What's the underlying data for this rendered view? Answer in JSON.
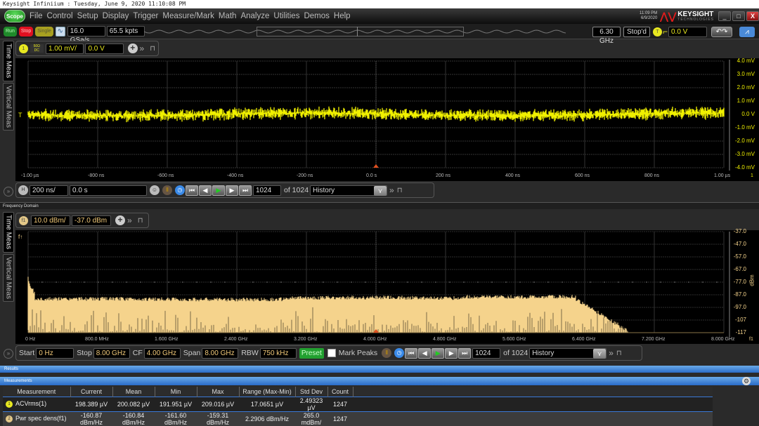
{
  "title_bar": "Keysight Infiniium : Tuesday, June 9, 2020 11:10:08 PM",
  "menu": {
    "scope_button": "Scope",
    "items": [
      "File",
      "Control",
      "Setup",
      "Display",
      "Trigger",
      "Measure/Mark",
      "Math",
      "Analyze",
      "Utilities",
      "Demos",
      "Help"
    ],
    "clock_time": "11:09 PM",
    "clock_date": "6/9/2020",
    "brand": "KEYSIGHT",
    "brand_sub": "TECHNOLOGIES"
  },
  "toolbar": {
    "run": "Run",
    "stop": "Stop",
    "single": "Single",
    "sample_rate": "16.0 GSa/s",
    "memory_depth": "65.5 kpts",
    "bandwidth": "6.30 GHz",
    "acq_status": "Stop'd",
    "trigger_badge": "T",
    "trigger_level": "0.0 V"
  },
  "side_tabs": {
    "time_meas": "Time Meas",
    "vertical_meas": "Vertical Meas"
  },
  "time_panel": {
    "channel_badge": "1",
    "impedance": "50Ω DC",
    "scale": "1.00 mV/",
    "offset": "0.0 V",
    "y_labels": [
      "4.0 mV",
      "3.0 mV",
      "2.0 mV",
      "1.0 mV",
      "0.0 V",
      "-1.0 mV",
      "-2.0 mV",
      "-3.0 mV",
      "-4.0 mV"
    ],
    "x_labels": [
      "-1.00 µs",
      "-800 ns",
      "-600 ns",
      "-400 ns",
      "-200 ns",
      "0.0 s",
      "200 ns",
      "400 ns",
      "600 ns",
      "800 ns",
      "1.00 µs"
    ],
    "right_marker": "1",
    "waveform_color": "#f0f000"
  },
  "horizontal_bar": {
    "badge": "H",
    "time_scale": "200 ns/",
    "delay": "0.0 s",
    "segment": "1024",
    "of_label": "of 1024",
    "history": "History"
  },
  "freq_section_title": "Frequency Domain",
  "freq_panel": {
    "badge": "f1",
    "scale": "10.0 dBm/",
    "offset": "-37.0 dBm",
    "y_labels": [
      "-37.0",
      "-47.0",
      "-57.0",
      "-67.0",
      "-77.0",
      "-87.0",
      "-97.0",
      "-107",
      "-117"
    ],
    "y_unit": "dBm",
    "x_labels": [
      "0 Hz",
      "800.0 MHz",
      "1.600 GHz",
      "2.400 GHz",
      "3.200 GHz",
      "4.000 GHz",
      "4.800 GHz",
      "5.600 GHz",
      "6.400 GHz",
      "7.200 GHz",
      "8.000 GHz"
    ],
    "right_marker": "f1",
    "spectrum_color": "#f5d38c"
  },
  "freq_bar": {
    "start_label": "Start",
    "start": "0 Hz",
    "stop_label": "Stop",
    "stop": "8.00 GHz",
    "cf_label": "CF",
    "cf": "4.00 GHz",
    "span_label": "Span",
    "span": "8.00 GHz",
    "rbw_label": "RBW",
    "rbw": "750 kHz",
    "preset": "Preset",
    "mark_peaks": "Mark Peaks",
    "segment": "1024",
    "of_label": "of 1024",
    "history": "History"
  },
  "results": {
    "title": "Results",
    "measurements_title": "Measurements",
    "columns": [
      "Measurement",
      "Current",
      "Mean",
      "Min",
      "Max",
      "Range (Max-Min)",
      "Std Dev",
      "Count"
    ],
    "rows": [
      {
        "badge": "1",
        "name": "ACVrms(1)",
        "current": "198.389 µV",
        "mean": "200.082 µV",
        "min": "191.951 µV",
        "max": "209.016 µV",
        "range": "17.0651 µV",
        "std": "2.49323 µV",
        "count": "1247"
      },
      {
        "badge": "2",
        "name": "Pwr spec dens(f1)",
        "current": "-160.87 dBm/Hz",
        "mean": "-160.84 dBm/Hz",
        "min": "-161.60 dBm/Hz",
        "max": "-159.31 dBm/Hz",
        "range": "2.2906 dBm/Hz",
        "std": "265.0 mdBm/",
        "count": "1247"
      }
    ]
  }
}
